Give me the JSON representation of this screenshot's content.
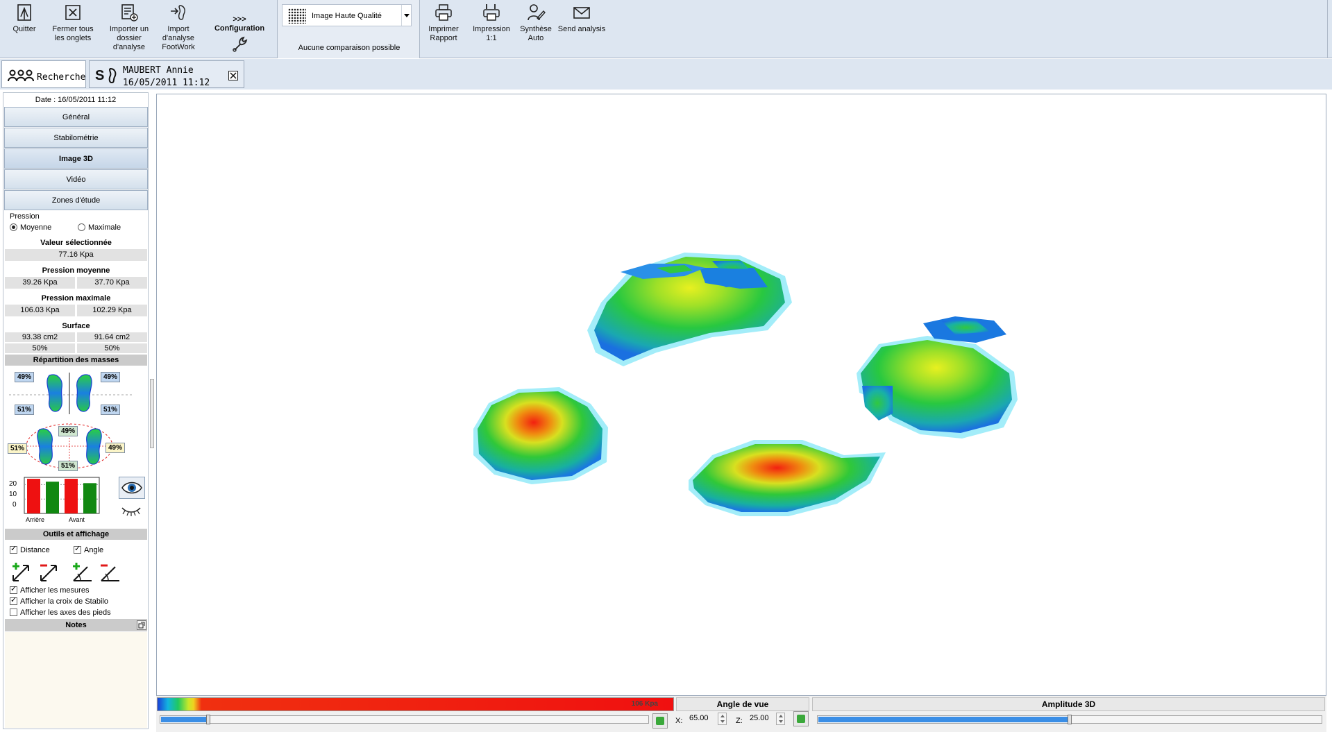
{
  "toolbar": {
    "quit": "Quitter",
    "close_tabs_1": "Fermer tous",
    "close_tabs_2": "les onglets",
    "import_folder_1": "Importer un",
    "import_folder_2": "dossier",
    "import_folder_3": "d'analyse",
    "import_fw_1": "Import",
    "import_fw_2": "d'analyse",
    "import_fw_3": "FootWork",
    "config_arrows": ">>>",
    "config": "Configuration",
    "quality": "Image Haute Qualité",
    "compare_note": "Aucune comparaison possible",
    "print_report_1": "Imprimer",
    "print_report_2": "Rapport",
    "print_11_1": "Impression",
    "print_11_2": "1:1",
    "synth_1": "Synthèse",
    "synth_2": "Auto",
    "send": "Send analysis"
  },
  "tabs": {
    "search": "Recherche",
    "patient_name": "MAUBERT Annie",
    "patient_date": "16/05/2011 11:12"
  },
  "sidebar": {
    "date": "Date : 16/05/2011 11:12",
    "nav": [
      "Général",
      "Stabilométrie",
      "Image 3D",
      "Vidéo",
      "Zones d'étude"
    ],
    "pression_label": "Pression",
    "radio_moyenne": "Moyenne",
    "radio_maximale": "Maximale",
    "valeur_sel_title": "Valeur sélectionnée",
    "valeur_sel": "77.16 Kpa",
    "pm_title": "Pression moyenne",
    "pm_left": "39.26 Kpa",
    "pm_right": "37.70 Kpa",
    "pmax_title": "Pression maximale",
    "pmax_left": "106.03 Kpa",
    "pmax_right": "102.29 Kpa",
    "surface_title": "Surface",
    "surf_left": "93.38 cm2",
    "surf_right": "91.64 cm2",
    "surf_pct_left": "50%",
    "surf_pct_right": "50%",
    "repartition_title": "Répartition des masses",
    "rep": {
      "top_left": "49%",
      "top_right": "49%",
      "mid_left": "51%",
      "mid_right": "51%",
      "front": "49%",
      "back": "51%",
      "side_left": "51%",
      "side_right": "49%"
    },
    "bar_chart": {
      "y_ticks": [
        "20",
        "10",
        "0"
      ],
      "x_left": "Arrière",
      "x_right": "Avant",
      "values": [
        24,
        22,
        24,
        21
      ],
      "colors": [
        "#ee1111",
        "#118811",
        "#ee1111",
        "#118811"
      ],
      "max": 25
    },
    "outils_title": "Outils et affichage",
    "distance": "Distance",
    "angle": "Angle",
    "afficher_mesures": "Afficher les mesures",
    "afficher_croix": "Afficher la croix de Stabilo",
    "afficher_axes": "Afficher les axes des pieds",
    "notes_title": "Notes"
  },
  "bottom": {
    "scale_max": "106 Kpa",
    "angle_title": "Angle de vue",
    "x_label": "X:",
    "x_value": "65.00",
    "z_label": "Z:",
    "z_value": "25.00",
    "amplitude_title": "Amplitude 3D",
    "left_slider_pct": 0.095,
    "amplitude_pct": 0.5
  },
  "colors": {
    "toolbar_bg": "#dde6f1",
    "heat_low": "#1a6ee0",
    "heat_mid": "#28c848",
    "heat_high": "#e82010"
  }
}
